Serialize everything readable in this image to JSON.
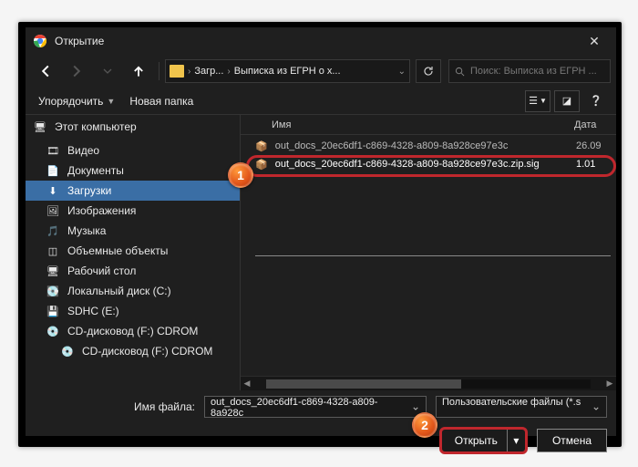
{
  "window": {
    "title": "Открытие",
    "close_label": "✕"
  },
  "nav": {
    "breadcrumb": {
      "seg1": "Загр...",
      "seg2": "Выписка из ЕГРН о х..."
    },
    "search_placeholder": "Поиск: Выписка из ЕГРН ..."
  },
  "toolbar": {
    "organize": "Упорядочить",
    "new_folder": "Новая папка"
  },
  "sidebar": {
    "this_pc": "Этот компьютер",
    "items": [
      {
        "label": "Видео",
        "icon": "🎞"
      },
      {
        "label": "Документы",
        "icon": "📄"
      },
      {
        "label": "Загрузки",
        "icon": "⬇",
        "selected": true
      },
      {
        "label": "Изображения",
        "icon": "🖼"
      },
      {
        "label": "Музыка",
        "icon": "🎵"
      },
      {
        "label": "Объемные объекты",
        "icon": "◫"
      },
      {
        "label": "Рабочий стол",
        "icon": "🖥"
      },
      {
        "label": "Локальный диск (C:)",
        "icon": "💽"
      },
      {
        "label": "SDHC (E:)",
        "icon": "💾"
      },
      {
        "label": "CD-дисковод (F:) CDROM",
        "icon": "💿"
      },
      {
        "label": "CD-дисковод (F:) CDROM",
        "icon": "💿"
      }
    ]
  },
  "columns": {
    "name": "Имя",
    "date": "Дата"
  },
  "files": [
    {
      "name": "out_docs_20ec6df1-c869-4328-a809-8a928ce97e3c",
      "date": "26.09",
      "strike": true
    },
    {
      "name": "out_docs_20ec6df1-c869-4328-a809-8a928ce97e3c.zip.sig",
      "date": "1.01",
      "selected": true
    }
  ],
  "footer": {
    "filename_label": "Имя файла:",
    "filename_value": "out_docs_20ec6df1-c869-4328-a809-8a928c",
    "type_filter": "Пользовательские файлы (*.s",
    "open": "Открыть",
    "cancel": "Отмена"
  },
  "callouts": {
    "one": "1",
    "two": "2"
  }
}
